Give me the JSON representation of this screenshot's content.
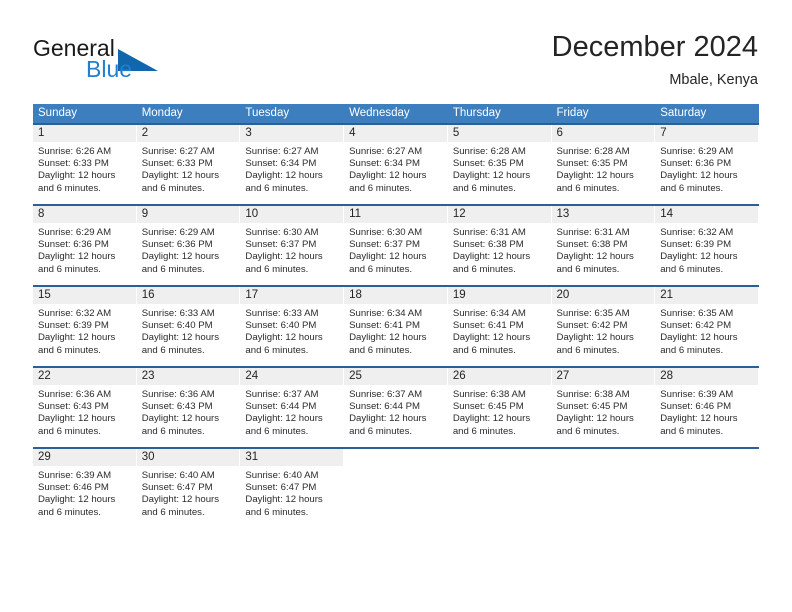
{
  "brand": {
    "line1": "General",
    "line2": "Blue",
    "mark": "triangle-logo",
    "blue": "#1f7fd0"
  },
  "header": {
    "title": "December 2024",
    "subtitle": "Mbale, Kenya"
  },
  "theme": {
    "header_blue": "#3c7ebe",
    "row_border_blue": "#2a6099",
    "daynum_band": "#efefef"
  },
  "weekdays": [
    "Sunday",
    "Monday",
    "Tuesday",
    "Wednesday",
    "Thursday",
    "Friday",
    "Saturday"
  ],
  "weeks": [
    [
      {
        "day": "1",
        "sunrise": "Sunrise: 6:26 AM",
        "sunset": "Sunset: 6:33 PM",
        "daylight1": "Daylight: 12 hours",
        "daylight2": "and 6 minutes."
      },
      {
        "day": "2",
        "sunrise": "Sunrise: 6:27 AM",
        "sunset": "Sunset: 6:33 PM",
        "daylight1": "Daylight: 12 hours",
        "daylight2": "and 6 minutes."
      },
      {
        "day": "3",
        "sunrise": "Sunrise: 6:27 AM",
        "sunset": "Sunset: 6:34 PM",
        "daylight1": "Daylight: 12 hours",
        "daylight2": "and 6 minutes."
      },
      {
        "day": "4",
        "sunrise": "Sunrise: 6:27 AM",
        "sunset": "Sunset: 6:34 PM",
        "daylight1": "Daylight: 12 hours",
        "daylight2": "and 6 minutes."
      },
      {
        "day": "5",
        "sunrise": "Sunrise: 6:28 AM",
        "sunset": "Sunset: 6:35 PM",
        "daylight1": "Daylight: 12 hours",
        "daylight2": "and 6 minutes."
      },
      {
        "day": "6",
        "sunrise": "Sunrise: 6:28 AM",
        "sunset": "Sunset: 6:35 PM",
        "daylight1": "Daylight: 12 hours",
        "daylight2": "and 6 minutes."
      },
      {
        "day": "7",
        "sunrise": "Sunrise: 6:29 AM",
        "sunset": "Sunset: 6:36 PM",
        "daylight1": "Daylight: 12 hours",
        "daylight2": "and 6 minutes."
      }
    ],
    [
      {
        "day": "8",
        "sunrise": "Sunrise: 6:29 AM",
        "sunset": "Sunset: 6:36 PM",
        "daylight1": "Daylight: 12 hours",
        "daylight2": "and 6 minutes."
      },
      {
        "day": "9",
        "sunrise": "Sunrise: 6:29 AM",
        "sunset": "Sunset: 6:36 PM",
        "daylight1": "Daylight: 12 hours",
        "daylight2": "and 6 minutes."
      },
      {
        "day": "10",
        "sunrise": "Sunrise: 6:30 AM",
        "sunset": "Sunset: 6:37 PM",
        "daylight1": "Daylight: 12 hours",
        "daylight2": "and 6 minutes."
      },
      {
        "day": "11",
        "sunrise": "Sunrise: 6:30 AM",
        "sunset": "Sunset: 6:37 PM",
        "daylight1": "Daylight: 12 hours",
        "daylight2": "and 6 minutes."
      },
      {
        "day": "12",
        "sunrise": "Sunrise: 6:31 AM",
        "sunset": "Sunset: 6:38 PM",
        "daylight1": "Daylight: 12 hours",
        "daylight2": "and 6 minutes."
      },
      {
        "day": "13",
        "sunrise": "Sunrise: 6:31 AM",
        "sunset": "Sunset: 6:38 PM",
        "daylight1": "Daylight: 12 hours",
        "daylight2": "and 6 minutes."
      },
      {
        "day": "14",
        "sunrise": "Sunrise: 6:32 AM",
        "sunset": "Sunset: 6:39 PM",
        "daylight1": "Daylight: 12 hours",
        "daylight2": "and 6 minutes."
      }
    ],
    [
      {
        "day": "15",
        "sunrise": "Sunrise: 6:32 AM",
        "sunset": "Sunset: 6:39 PM",
        "daylight1": "Daylight: 12 hours",
        "daylight2": "and 6 minutes."
      },
      {
        "day": "16",
        "sunrise": "Sunrise: 6:33 AM",
        "sunset": "Sunset: 6:40 PM",
        "daylight1": "Daylight: 12 hours",
        "daylight2": "and 6 minutes."
      },
      {
        "day": "17",
        "sunrise": "Sunrise: 6:33 AM",
        "sunset": "Sunset: 6:40 PM",
        "daylight1": "Daylight: 12 hours",
        "daylight2": "and 6 minutes."
      },
      {
        "day": "18",
        "sunrise": "Sunrise: 6:34 AM",
        "sunset": "Sunset: 6:41 PM",
        "daylight1": "Daylight: 12 hours",
        "daylight2": "and 6 minutes."
      },
      {
        "day": "19",
        "sunrise": "Sunrise: 6:34 AM",
        "sunset": "Sunset: 6:41 PM",
        "daylight1": "Daylight: 12 hours",
        "daylight2": "and 6 minutes."
      },
      {
        "day": "20",
        "sunrise": "Sunrise: 6:35 AM",
        "sunset": "Sunset: 6:42 PM",
        "daylight1": "Daylight: 12 hours",
        "daylight2": "and 6 minutes."
      },
      {
        "day": "21",
        "sunrise": "Sunrise: 6:35 AM",
        "sunset": "Sunset: 6:42 PM",
        "daylight1": "Daylight: 12 hours",
        "daylight2": "and 6 minutes."
      }
    ],
    [
      {
        "day": "22",
        "sunrise": "Sunrise: 6:36 AM",
        "sunset": "Sunset: 6:43 PM",
        "daylight1": "Daylight: 12 hours",
        "daylight2": "and 6 minutes."
      },
      {
        "day": "23",
        "sunrise": "Sunrise: 6:36 AM",
        "sunset": "Sunset: 6:43 PM",
        "daylight1": "Daylight: 12 hours",
        "daylight2": "and 6 minutes."
      },
      {
        "day": "24",
        "sunrise": "Sunrise: 6:37 AM",
        "sunset": "Sunset: 6:44 PM",
        "daylight1": "Daylight: 12 hours",
        "daylight2": "and 6 minutes."
      },
      {
        "day": "25",
        "sunrise": "Sunrise: 6:37 AM",
        "sunset": "Sunset: 6:44 PM",
        "daylight1": "Daylight: 12 hours",
        "daylight2": "and 6 minutes."
      },
      {
        "day": "26",
        "sunrise": "Sunrise: 6:38 AM",
        "sunset": "Sunset: 6:45 PM",
        "daylight1": "Daylight: 12 hours",
        "daylight2": "and 6 minutes."
      },
      {
        "day": "27",
        "sunrise": "Sunrise: 6:38 AM",
        "sunset": "Sunset: 6:45 PM",
        "daylight1": "Daylight: 12 hours",
        "daylight2": "and 6 minutes."
      },
      {
        "day": "28",
        "sunrise": "Sunrise: 6:39 AM",
        "sunset": "Sunset: 6:46 PM",
        "daylight1": "Daylight: 12 hours",
        "daylight2": "and 6 minutes."
      }
    ],
    [
      {
        "day": "29",
        "sunrise": "Sunrise: 6:39 AM",
        "sunset": "Sunset: 6:46 PM",
        "daylight1": "Daylight: 12 hours",
        "daylight2": "and 6 minutes."
      },
      {
        "day": "30",
        "sunrise": "Sunrise: 6:40 AM",
        "sunset": "Sunset: 6:47 PM",
        "daylight1": "Daylight: 12 hours",
        "daylight2": "and 6 minutes."
      },
      {
        "day": "31",
        "sunrise": "Sunrise: 6:40 AM",
        "sunset": "Sunset: 6:47 PM",
        "daylight1": "Daylight: 12 hours",
        "daylight2": "and 6 minutes."
      },
      {
        "day": "",
        "sunrise": "",
        "sunset": "",
        "daylight1": "",
        "daylight2": ""
      },
      {
        "day": "",
        "sunrise": "",
        "sunset": "",
        "daylight1": "",
        "daylight2": ""
      },
      {
        "day": "",
        "sunrise": "",
        "sunset": "",
        "daylight1": "",
        "daylight2": ""
      },
      {
        "day": "",
        "sunrise": "",
        "sunset": "",
        "daylight1": "",
        "daylight2": ""
      }
    ]
  ]
}
